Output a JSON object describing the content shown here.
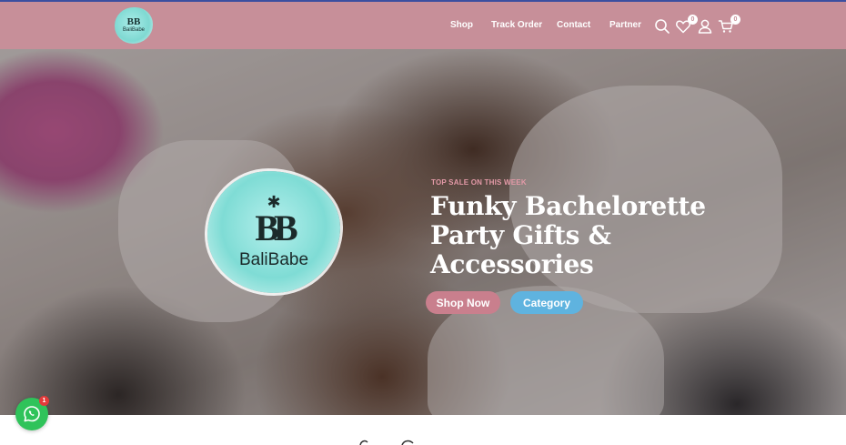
{
  "header": {
    "logo": {
      "mark": "BB",
      "text": "BaliBabe"
    },
    "nav": [
      "Shop",
      "Track Order",
      "Contact",
      "Partner"
    ],
    "icons": {
      "search": "search-icon",
      "wishlist": "heart-icon",
      "account": "user-icon",
      "cart": "cart-icon"
    },
    "wishlist_count": "0",
    "cart_count": "0"
  },
  "hero": {
    "logo": {
      "mark": "BB",
      "text": "BaliBabe"
    },
    "eyebrow": "TOP SALE ON THIS WEEK",
    "title_lines": [
      "Funky Bachelorette",
      "Party Gifts &",
      "Accessories"
    ],
    "buttons": {
      "shop": "Shop Now",
      "category": "Category"
    }
  },
  "chat": {
    "icon": "whatsapp-icon",
    "badge": "1"
  },
  "colors": {
    "header_bg": "#c78f99",
    "shop_button": "#c97f8d",
    "category_button": "#5fb3df",
    "eyebrow": "#e49aa8",
    "whatsapp": "#2fc35a"
  }
}
